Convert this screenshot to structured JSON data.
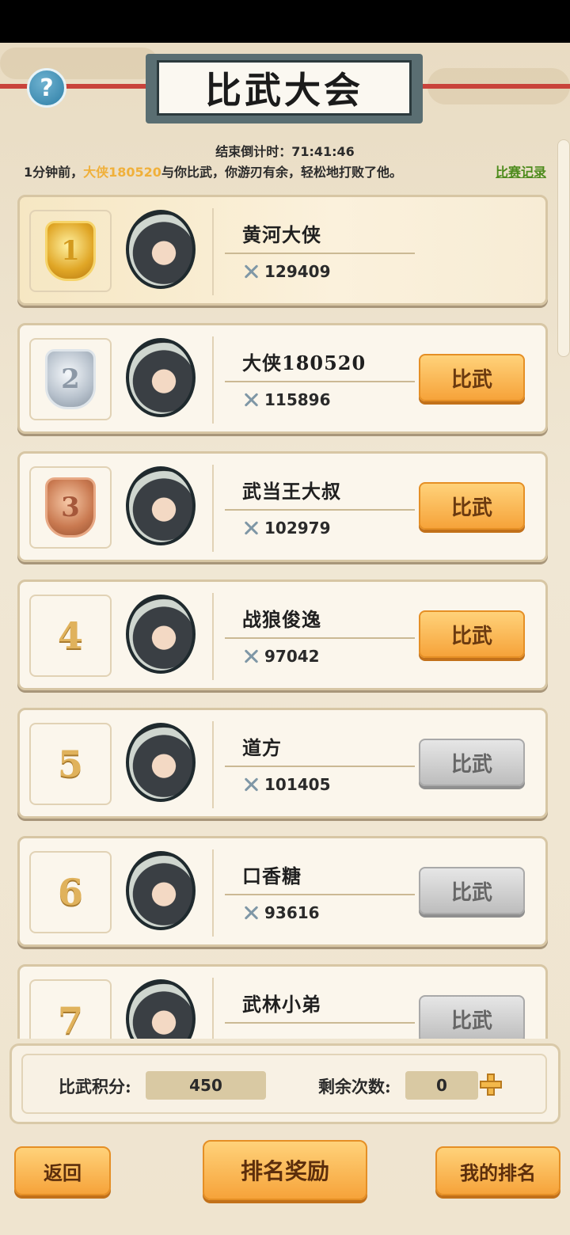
{
  "header": {
    "title": "比武大会",
    "help_label": "?"
  },
  "countdown": {
    "label": "结束倒计时：",
    "value": "71:41:46"
  },
  "message": {
    "prefix": "1分钟前，",
    "player": "大侠180520",
    "text": "与你比武，你游刃有余，轻松地打败了他。",
    "link": "比赛记录"
  },
  "rankings": [
    {
      "rank": "1",
      "name": "黄河大侠",
      "power": "129409",
      "button": "",
      "enabled": false,
      "medal": "gold"
    },
    {
      "rank": "2",
      "name": "大侠180520",
      "power": "115896",
      "button": "比武",
      "enabled": true,
      "medal": "silver"
    },
    {
      "rank": "3",
      "name": "武当王大叔",
      "power": "102979",
      "button": "比武",
      "enabled": true,
      "medal": "bronze"
    },
    {
      "rank": "4",
      "name": "战狼俊逸",
      "power": "97042",
      "button": "比武",
      "enabled": true,
      "medal": ""
    },
    {
      "rank": "5",
      "name": "道方",
      "power": "101405",
      "button": "比武",
      "enabled": false,
      "medal": ""
    },
    {
      "rank": "6",
      "name": "口香糖",
      "power": "93616",
      "button": "比武",
      "enabled": false,
      "medal": ""
    },
    {
      "rank": "7",
      "name": "武林小弟",
      "power": "",
      "button": "比武",
      "enabled": false,
      "medal": ""
    }
  ],
  "score": {
    "points_label": "比武积分:",
    "points_value": "450",
    "remaining_label": "剩余次数:",
    "remaining_value": "0"
  },
  "footer": {
    "back": "返回",
    "rewards": "排名奖励",
    "my_rank": "我的排名"
  },
  "colors": {
    "accent": "#f6a33a",
    "highlight": "#f0b03a",
    "link": "#4d8b1c",
    "disabled": "#bdbdbd"
  }
}
